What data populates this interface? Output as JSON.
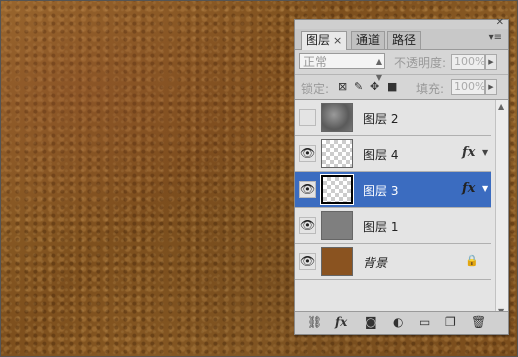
{
  "panel": {
    "tabs": [
      {
        "label": "图层",
        "close": "×",
        "active": true
      },
      {
        "label": "通道",
        "active": false
      },
      {
        "label": "路径",
        "active": false
      }
    ],
    "window_close": "✕",
    "menu_icon": "▾≡",
    "blend_mode": "正常",
    "opacity_label": "不透明度:",
    "opacity_value": "100%",
    "lock_label": "锁定:",
    "fill_label": "填充:",
    "fill_value": "100%"
  },
  "layers": [
    {
      "name": "图层 2",
      "visible": false,
      "thumb": "cloud",
      "fx": false,
      "selected": false
    },
    {
      "name": "图层 4",
      "visible": true,
      "thumb": "transparent",
      "fx": true,
      "selected": false
    },
    {
      "name": "图层 3",
      "visible": true,
      "thumb": "transparent",
      "fx": true,
      "selected": true
    },
    {
      "name": "图层 1",
      "visible": true,
      "thumb": "gray",
      "fx": false,
      "selected": false
    },
    {
      "name": "背景",
      "visible": true,
      "thumb": "brown",
      "fx": false,
      "locked": true,
      "selected": false
    }
  ],
  "fx_label": "fx",
  "colors": {
    "selection": "#3b6cc0",
    "canvas": "#8a5a23",
    "panel": "#d6d6d6"
  }
}
